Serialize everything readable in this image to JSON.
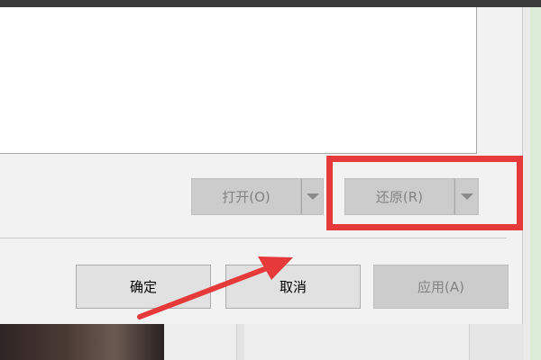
{
  "restore_split": {
    "label": "还原(R)"
  },
  "open_split": {
    "label": "打开(O)"
  },
  "footer": {
    "ok_label": "确定",
    "cancel_label": "取消",
    "apply_label": "应用(A)"
  },
  "annotation": {
    "highlight_color": "#e63a3a",
    "arrow_color": "#e63a3a"
  }
}
